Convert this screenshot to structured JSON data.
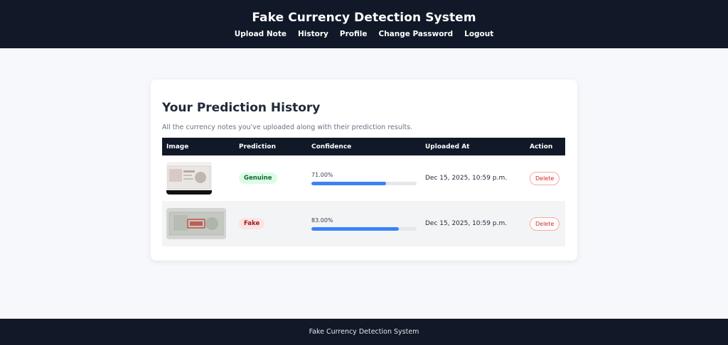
{
  "header": {
    "title": "Fake Currency Detection System",
    "nav": [
      {
        "label": "Upload Note"
      },
      {
        "label": "History"
      },
      {
        "label": "Profile"
      },
      {
        "label": "Change Password"
      },
      {
        "label": "Logout"
      }
    ]
  },
  "main": {
    "title": "Your Prediction History",
    "subtitle": "All the currency notes you've uploaded along with their prediction results.",
    "table": {
      "columns": [
        "Image",
        "Prediction",
        "Confidence",
        "Uploaded At",
        "Action"
      ],
      "rows": [
        {
          "image_icon": "banknote-thumbnail",
          "prediction": "Genuine",
          "confidence": "71.00%",
          "confidence_fraction": 0.71,
          "uploaded_at": "Dec 15, 2025, 10:59 p.m.",
          "action": "Delete"
        },
        {
          "image_icon": "banknote-thumbnail",
          "prediction": "Fake",
          "confidence": "83.00%",
          "confidence_fraction": 0.83,
          "uploaded_at": "Dec 15, 2025, 10:59 p.m.",
          "action": "Delete"
        }
      ]
    }
  },
  "footer": {
    "text": "Fake Currency Detection System"
  },
  "colors": {
    "header_bg": "#111827",
    "accent": "#3b82f6",
    "genuine": "#166534",
    "fake": "#991b1b"
  }
}
